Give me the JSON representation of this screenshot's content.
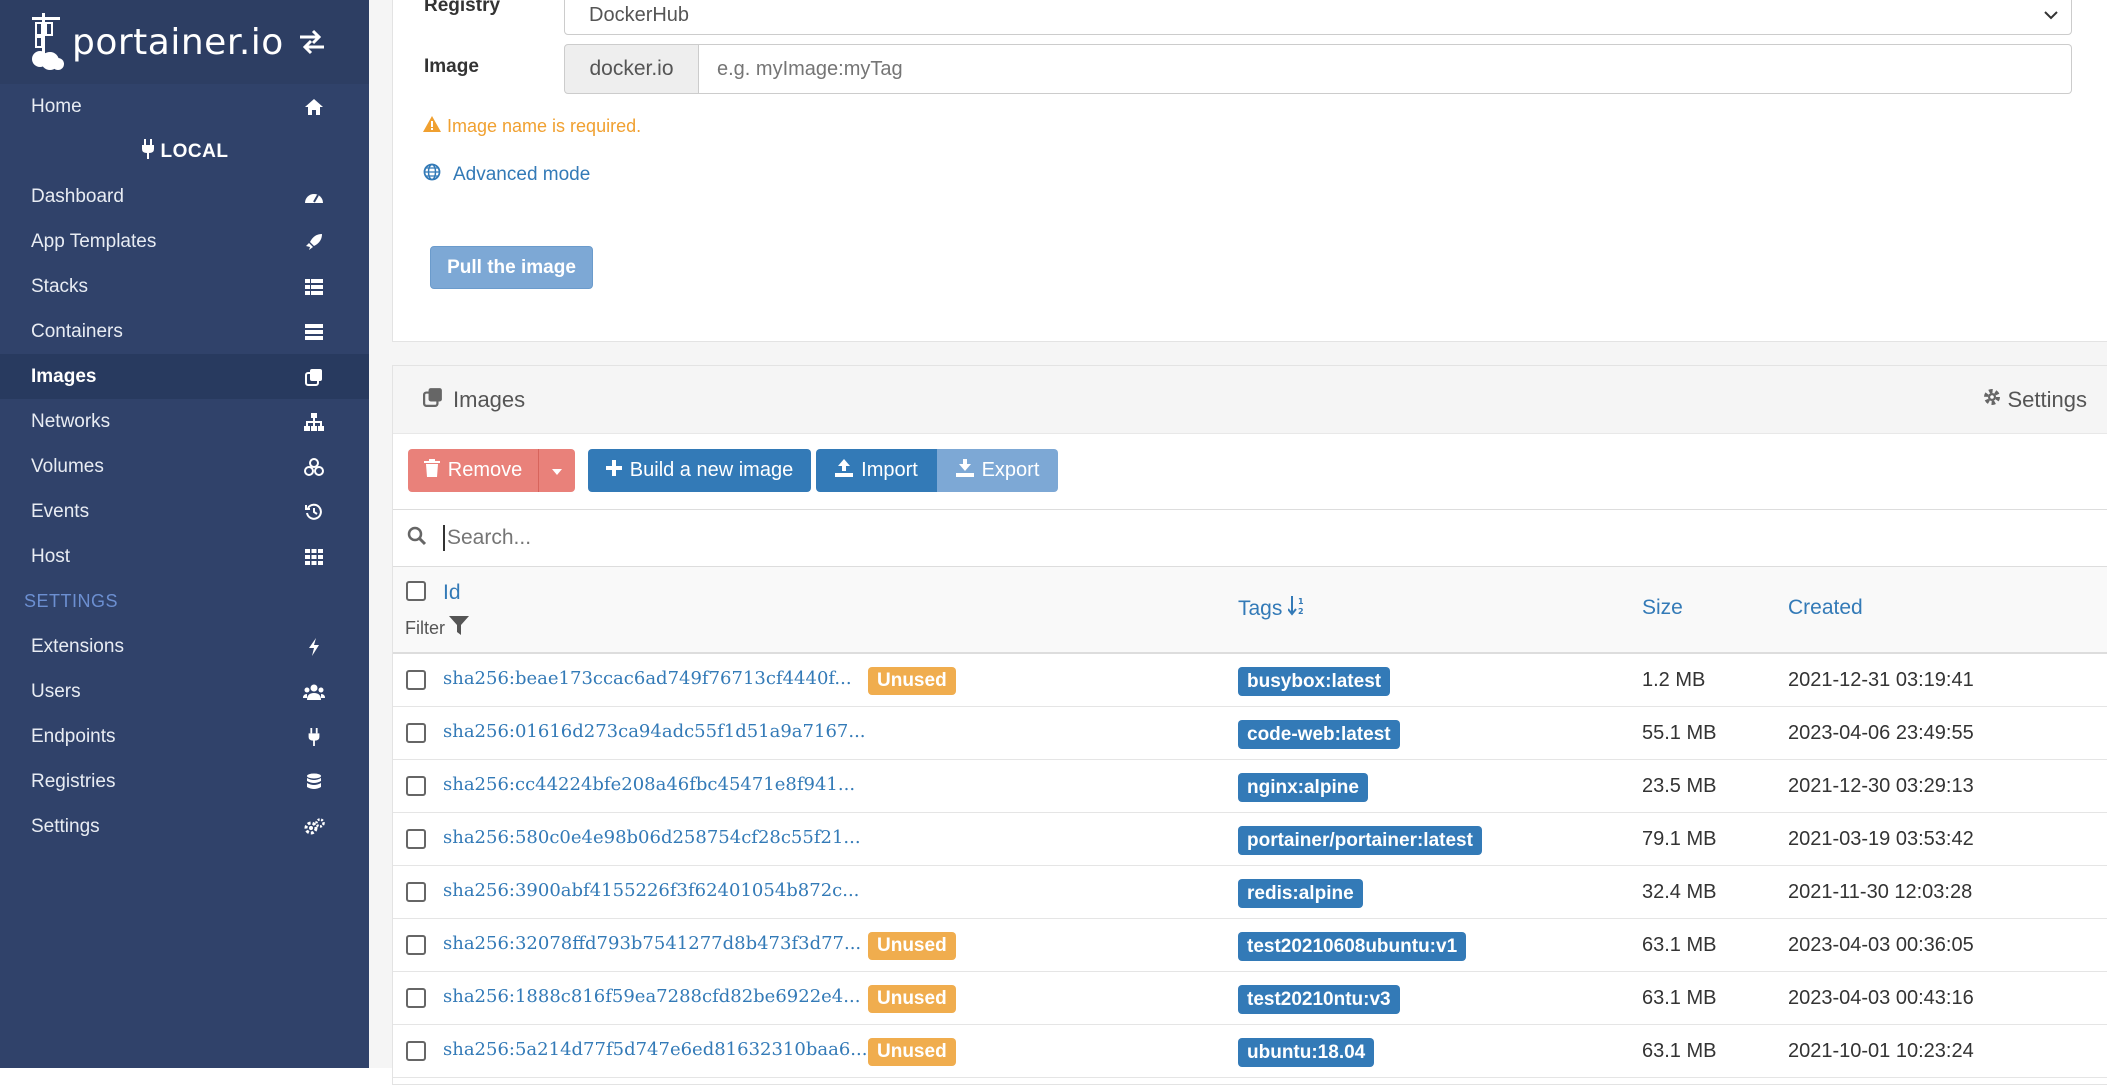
{
  "brand": {
    "name": "portainer.io"
  },
  "sidebar": {
    "home": "Home",
    "environment": "LOCAL",
    "items": [
      {
        "label": "Dashboard"
      },
      {
        "label": "App Templates"
      },
      {
        "label": "Stacks"
      },
      {
        "label": "Containers"
      },
      {
        "label": "Images"
      },
      {
        "label": "Networks"
      },
      {
        "label": "Volumes"
      },
      {
        "label": "Events"
      },
      {
        "label": "Host"
      }
    ],
    "settings_header": "SETTINGS",
    "settings_items": [
      {
        "label": "Extensions"
      },
      {
        "label": "Users"
      },
      {
        "label": "Endpoints"
      },
      {
        "label": "Registries"
      },
      {
        "label": "Settings"
      }
    ]
  },
  "pull": {
    "registry_label": "Registry",
    "registry_value": "DockerHub",
    "image_label": "Image",
    "image_prefix": "docker.io",
    "image_placeholder": "e.g. myImage:myTag",
    "warning": "Image name is required.",
    "advanced_mode": "Advanced mode",
    "pull_button": "Pull the image"
  },
  "images": {
    "title": "Images",
    "settings": "Settings",
    "toolbar": {
      "remove": "Remove",
      "build": "Build a new image",
      "import": "Import",
      "export": "Export"
    },
    "search_placeholder": "Search...",
    "columns": {
      "id": "Id",
      "filter": "Filter",
      "tags": "Tags",
      "size": "Size",
      "created": "Created"
    },
    "unused_label": "Unused",
    "rows": [
      {
        "id": "sha256:beae173ccac6ad749f76713cf4440f...",
        "unused": true,
        "tag": "busybox:latest",
        "size": "1.2 MB",
        "created": "2021-12-31 03:19:41"
      },
      {
        "id": "sha256:01616d273ca94adc55f1d51a9a7167...",
        "unused": false,
        "tag": "code-web:latest",
        "size": "55.1 MB",
        "created": "2023-04-06 23:49:55"
      },
      {
        "id": "sha256:cc44224bfe208a46fbc45471e8f941...",
        "unused": false,
        "tag": "nginx:alpine",
        "size": "23.5 MB",
        "created": "2021-12-30 03:29:13"
      },
      {
        "id": "sha256:580c0e4e98b06d258754cf28c55f21...",
        "unused": false,
        "tag": "portainer/portainer:latest",
        "size": "79.1 MB",
        "created": "2021-03-19 03:53:42"
      },
      {
        "id": "sha256:3900abf4155226f3f62401054b872c...",
        "unused": false,
        "tag": "redis:alpine",
        "size": "32.4 MB",
        "created": "2021-11-30 12:03:28"
      },
      {
        "id": "sha256:32078ffd793b7541277d8b473f3d77...",
        "unused": true,
        "tag": "test20210608ubuntu:v1",
        "size": "63.1 MB",
        "created": "2023-04-03 00:36:05"
      },
      {
        "id": "sha256:1888c816f59ea7288cfd82be6922e4...",
        "unused": true,
        "tag": "test20210ntu:v3",
        "size": "63.1 MB",
        "created": "2023-04-03 00:43:16"
      },
      {
        "id": "sha256:5a214d77f5d747e6ed81632310baa6...",
        "unused": true,
        "tag": "ubuntu:18.04",
        "size": "63.1 MB",
        "created": "2021-10-01 10:23:24"
      }
    ]
  }
}
